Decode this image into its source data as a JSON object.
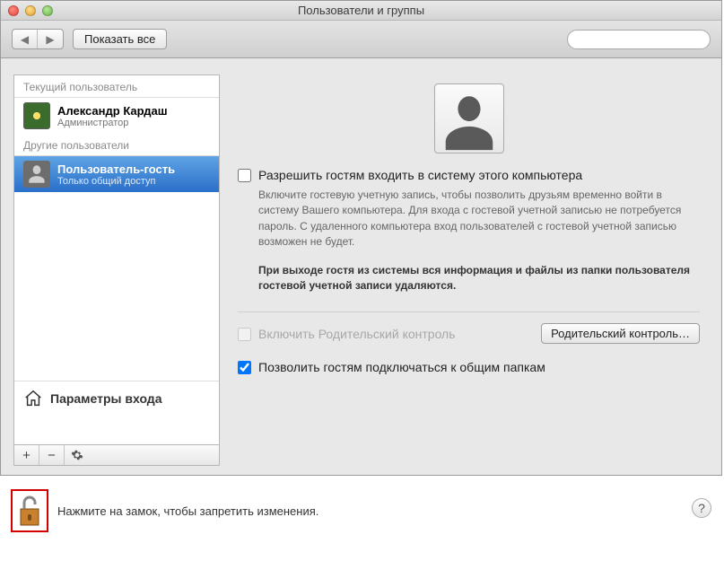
{
  "window": {
    "title": "Пользователи и группы"
  },
  "toolbar": {
    "show_all": "Показать все",
    "search_placeholder": ""
  },
  "sidebar": {
    "current_label": "Текущий пользователь",
    "other_label": "Другие пользователи",
    "current_user": {
      "name": "Александр Кардаш",
      "role": "Администратор"
    },
    "guest_user": {
      "name": "Пользователь-гость",
      "role": "Только общий доступ"
    },
    "login_options": "Параметры входа"
  },
  "main": {
    "allow_login_label": "Разрешить гостям входить в систему этого компьютера",
    "allow_login_checked": false,
    "allow_login_desc": "Включите гостевую учетную запись, чтобы позволить друзьям временно войти в систему Вашего компьютера. Для входа с гостевой учетной записью не потребуется пароль. С удаленного компьютера вход пользователей с гостевой учетной записью возможен не будет.",
    "logout_desc": "При выходе гостя из системы вся информация и файлы из папки пользователя гостевой учетной записи удаляются.",
    "parental_check_label": "Включить Родительский контроль",
    "parental_check_checked": false,
    "parental_button": "Родительский контроль…",
    "shared_folders_label": "Позволить гостям подключаться к общим папкам",
    "shared_folders_checked": true
  },
  "footer": {
    "lock_text": "Нажмите на замок, чтобы запретить изменения."
  }
}
